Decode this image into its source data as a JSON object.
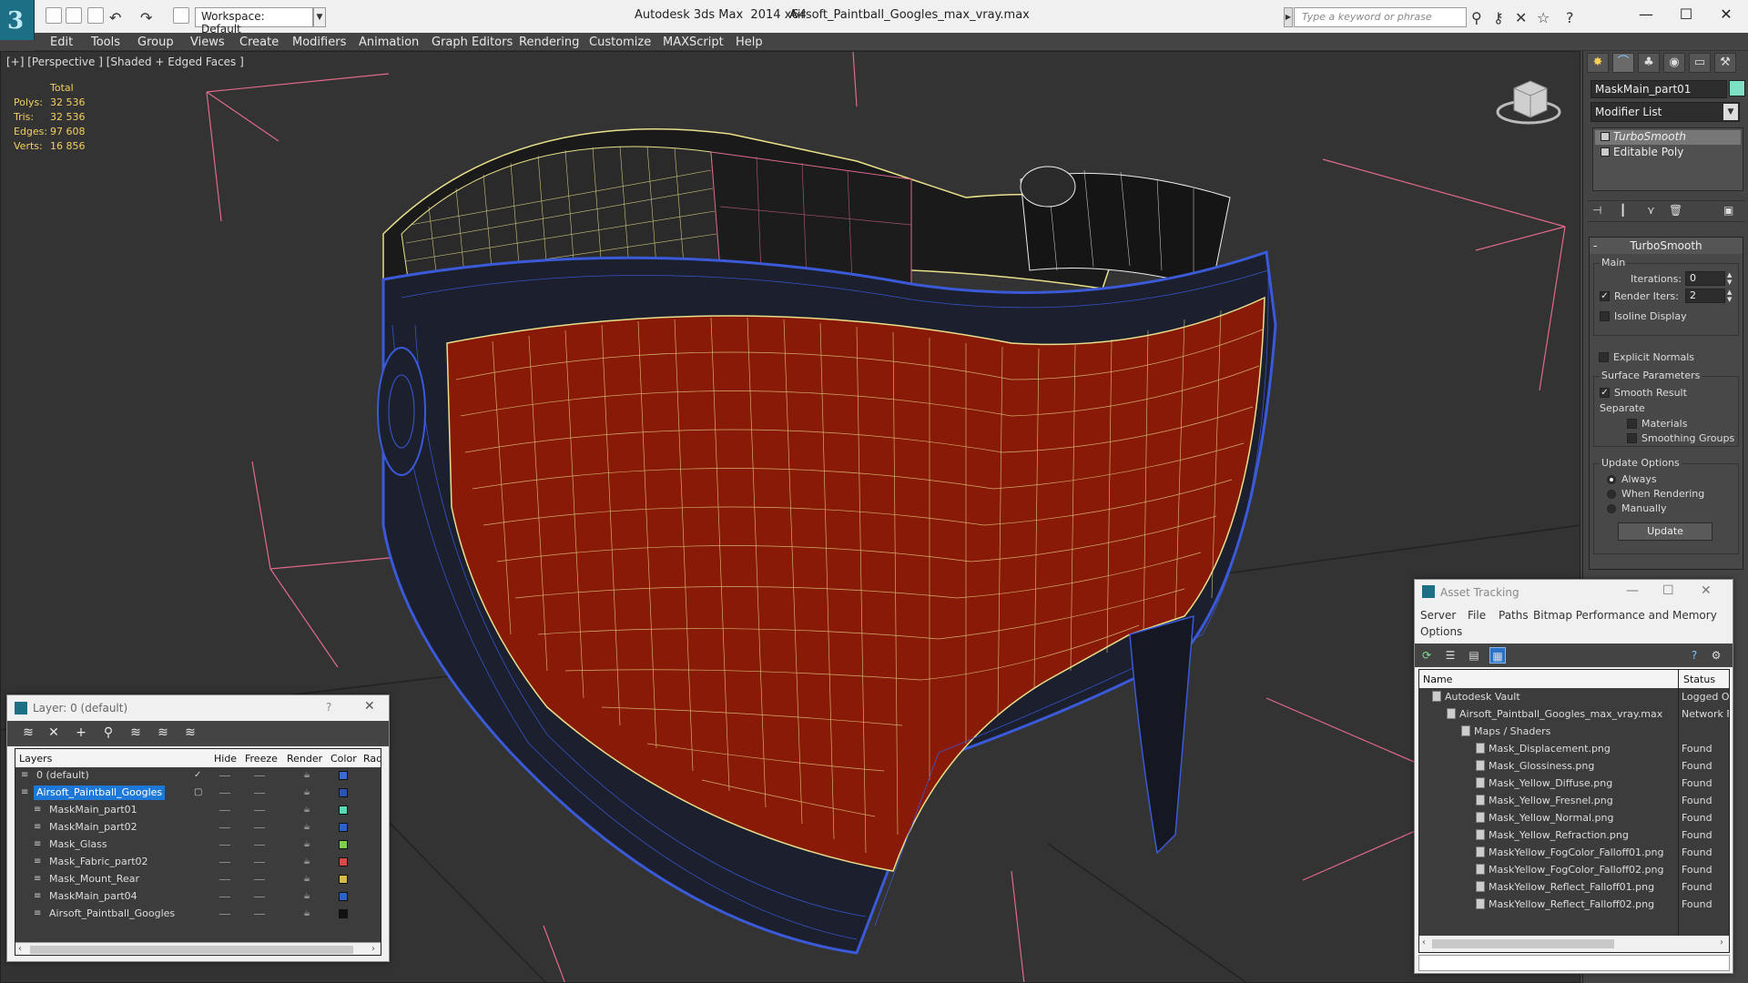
{
  "titlebar": {
    "workspace": "Workspace: Default",
    "app_title": "Autodesk 3ds Max  2014 x64",
    "file_title": "Airsoft_Paintball_Googles_max_vray.max",
    "search_placeholder": "Type a keyword or phrase",
    "minimize": "—",
    "maximize": "☐",
    "close": "✕"
  },
  "menu": [
    "Edit",
    "Tools",
    "Group",
    "Views",
    "Create",
    "Modifiers",
    "Animation",
    "Graph Editors",
    "Rendering",
    "Customize",
    "MAXScript",
    "Help"
  ],
  "viewport": {
    "label": "[+] [Perspective ] [Shaded + Edged Faces ]",
    "stats": {
      "header": "Total",
      "rows": [
        {
          "label": "Polys:",
          "value": "32 536"
        },
        {
          "label": "Tris:",
          "value": "32 536"
        },
        {
          "label": "Edges:",
          "value": "97 608"
        },
        {
          "label": "Verts:",
          "value": "16 856"
        }
      ]
    },
    "colors": {
      "background": "#333333",
      "mask_red": "#8a1a08",
      "wire_blue": "#3a5ad8",
      "wire_yellow": "#e8e08a",
      "grid_pink": "#e06a8a"
    }
  },
  "command_panel": {
    "object_name": "MaskMain_part01",
    "object_color": "#7ee0c4",
    "modifier_list": "Modifier List",
    "stack": [
      "TurboSmooth",
      "Editable Poly"
    ],
    "rollout_title": "TurboSmooth",
    "main_group": "Main",
    "iterations_label": "Iterations:",
    "iterations_value": "0",
    "render_iters_label": "Render Iters:",
    "render_iters_value": "2",
    "render_iters_checked": true,
    "isoline_label": "Isoline Display",
    "explicit_normals_label": "Explicit Normals",
    "surface_group": "Surface Parameters",
    "smooth_result_label": "Smooth Result",
    "separate_label": "Separate",
    "materials_label": "Materials",
    "smoothing_groups_label": "Smoothing Groups",
    "update_group": "Update Options",
    "always_label": "Always",
    "when_rendering_label": "When Rendering",
    "manually_label": "Manually",
    "update_button": "Update"
  },
  "layer_window": {
    "title": "Layer: 0 (default)",
    "help": "?",
    "close": "✕",
    "columns": [
      "Layers",
      "Hide",
      "Freeze",
      "Render",
      "Color",
      "Rad"
    ],
    "rows": [
      {
        "name": "0 (default)",
        "color": "#3a6ad0",
        "indent": 0,
        "selected": false,
        "check": "✓"
      },
      {
        "name": "Airsoft_Paintball_Googles",
        "color": "#2a52b8",
        "indent": 0,
        "selected": true,
        "check": "▢"
      },
      {
        "name": "MaskMain_part01",
        "color": "#5ad8b8",
        "indent": 1,
        "selected": false,
        "check": ""
      },
      {
        "name": "MaskMain_part02",
        "color": "#2a62c8",
        "indent": 1,
        "selected": false,
        "check": ""
      },
      {
        "name": "Mask_Glass",
        "color": "#7ad04a",
        "indent": 1,
        "selected": false,
        "check": ""
      },
      {
        "name": "Mask_Fabric_part02",
        "color": "#d84a4a",
        "indent": 1,
        "selected": false,
        "check": ""
      },
      {
        "name": "Mask_Mount_Rear",
        "color": "#d8b84a",
        "indent": 1,
        "selected": false,
        "check": ""
      },
      {
        "name": "MaskMain_part04",
        "color": "#2a62c8",
        "indent": 1,
        "selected": false,
        "check": ""
      },
      {
        "name": "Airsoft_Paintball_Googles",
        "color": "#111111",
        "indent": 1,
        "selected": false,
        "check": ""
      }
    ]
  },
  "asset_window": {
    "title": "Asset Tracking",
    "menu": [
      "Server",
      "File",
      "Paths",
      "Bitmap Performance and Memory",
      "Options"
    ],
    "columns": [
      "Name",
      "Status"
    ],
    "rows": [
      {
        "name": "Autodesk Vault",
        "status": "Logged O",
        "level": 0
      },
      {
        "name": "Airsoft_Paintball_Googles_max_vray.max",
        "status": "Network F",
        "level": 1
      },
      {
        "name": "Maps / Shaders",
        "status": "",
        "level": 2
      },
      {
        "name": "Mask_Displacement.png",
        "status": "Found",
        "level": 3
      },
      {
        "name": "Mask_Glossiness.png",
        "status": "Found",
        "level": 3
      },
      {
        "name": "Mask_Yellow_Diffuse.png",
        "status": "Found",
        "level": 3
      },
      {
        "name": "Mask_Yellow_Fresnel.png",
        "status": "Found",
        "level": 3
      },
      {
        "name": "Mask_Yellow_Normal.png",
        "status": "Found",
        "level": 3
      },
      {
        "name": "Mask_Yellow_Refraction.png",
        "status": "Found",
        "level": 3
      },
      {
        "name": "MaskYellow_FogColor_Falloff01.png",
        "status": "Found",
        "level": 3
      },
      {
        "name": "MaskYellow_FogColor_Falloff02.png",
        "status": "Found",
        "level": 3
      },
      {
        "name": "MaskYellow_Reflect_Falloff01.png",
        "status": "Found",
        "level": 3
      },
      {
        "name": "MaskYellow_Reflect_Falloff02.png",
        "status": "Found",
        "level": 3
      }
    ]
  }
}
